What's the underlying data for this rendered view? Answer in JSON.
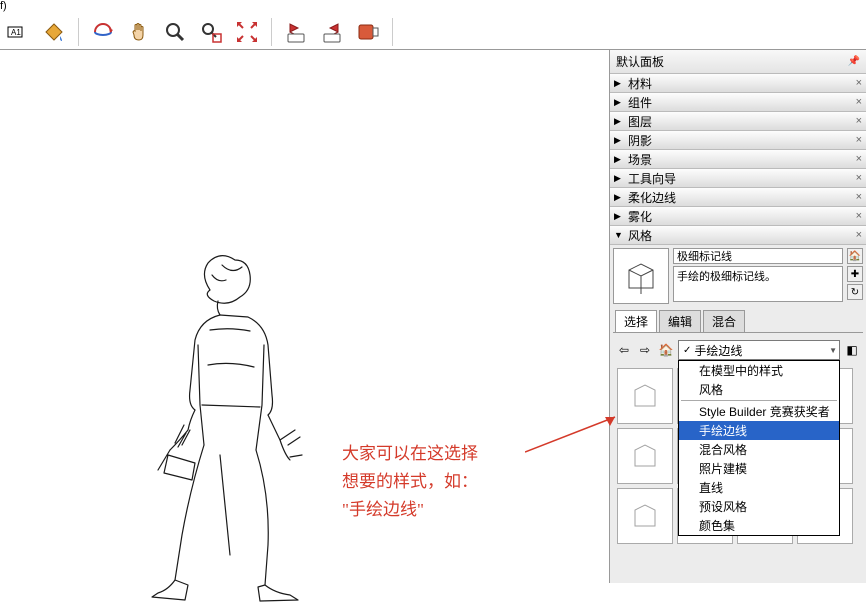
{
  "title": "f)",
  "panel_title": "默认面板",
  "accordion": [
    {
      "label": "材料",
      "open": false
    },
    {
      "label": "组件",
      "open": false
    },
    {
      "label": "图层",
      "open": false
    },
    {
      "label": "阴影",
      "open": false
    },
    {
      "label": "场景",
      "open": false
    },
    {
      "label": "工具向导",
      "open": false
    },
    {
      "label": "柔化边线",
      "open": false
    },
    {
      "label": "雾化",
      "open": false
    },
    {
      "label": "风格",
      "open": true
    }
  ],
  "style": {
    "name": "极细标记线",
    "desc": "手绘的极细标记线。"
  },
  "tabs": [
    "选择",
    "编辑",
    "混合"
  ],
  "active_tab": 0,
  "combo_value": "手绘边线",
  "dropdown": [
    {
      "label": "在模型中的样式",
      "sel": false
    },
    {
      "label": "风格",
      "sel": false
    },
    {
      "sep": true
    },
    {
      "label": "Style Builder 竞赛获奖者",
      "sel": false
    },
    {
      "label": "手绘边线",
      "sel": true
    },
    {
      "label": "混合风格",
      "sel": false
    },
    {
      "label": "照片建模",
      "sel": false
    },
    {
      "label": "直线",
      "sel": false
    },
    {
      "label": "预设风格",
      "sel": false
    },
    {
      "label": "颜色集",
      "sel": false
    }
  ],
  "annotation": {
    "line1": "大家可以在这选择",
    "line2": "想要的样式，如：",
    "line3": "\"手绘边线\""
  },
  "icons": {
    "dim": "dimension-tool",
    "label": "label-tool",
    "paint": "paint-bucket",
    "orbit": "orbit-tool",
    "pan": "pan-tool",
    "zoom": "zoom-tool",
    "zoomwin": "zoom-window",
    "extents": "zoom-extents",
    "prev": "previous-view",
    "next": "next-view",
    "style": "style-tool"
  }
}
